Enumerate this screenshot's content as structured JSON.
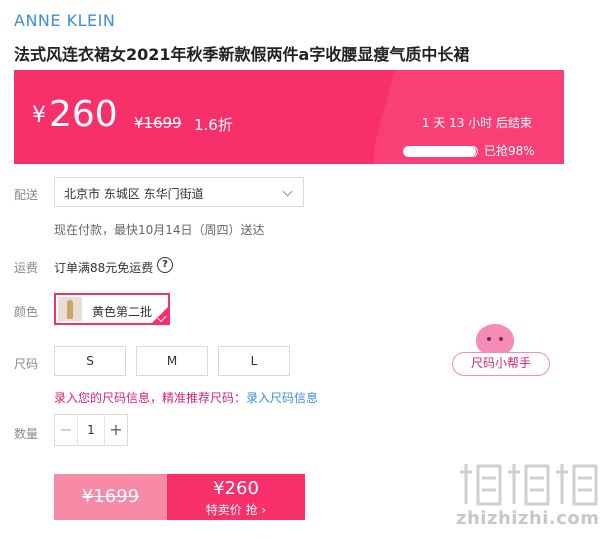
{
  "brand": "ANNE KLEIN",
  "product_title": "法式风连衣裙女2021年秋季新款假两件a字收腰显瘦气质中长裙",
  "price_banner": {
    "currency": "¥",
    "price": "260",
    "original_price": "¥1699",
    "discount": "1.6折",
    "countdown": "1 天 13 小时 后结束",
    "sold_progress": 0.98,
    "sold_text": "已抢98%",
    "color": "#f8306a"
  },
  "delivery": {
    "label": "配送",
    "address": "北京市 东城区 东华门街道",
    "estimate": "现在付款，最快10月14日（周四）送达"
  },
  "shipping": {
    "label": "运费",
    "text": "订单满88元免运费",
    "help_icon": "?"
  },
  "color": {
    "label": "颜色",
    "selected": "黄色第二批"
  },
  "size": {
    "label": "尺码",
    "options": [
      "S",
      "M",
      "L"
    ],
    "tip_prefix": "录入您的尺码信息，精准推荐尺码：",
    "tip_link": "录入尺码信息"
  },
  "size_helper": {
    "label": "尺码小帮手"
  },
  "quantity": {
    "label": "数量",
    "value": "1",
    "minus": "−",
    "plus": "+"
  },
  "buy": {
    "original_price": "¥1699",
    "price": "¥260",
    "cta": "特卖价 抢 ›"
  },
  "watermark": {
    "text": "zhizhizhi.com"
  }
}
